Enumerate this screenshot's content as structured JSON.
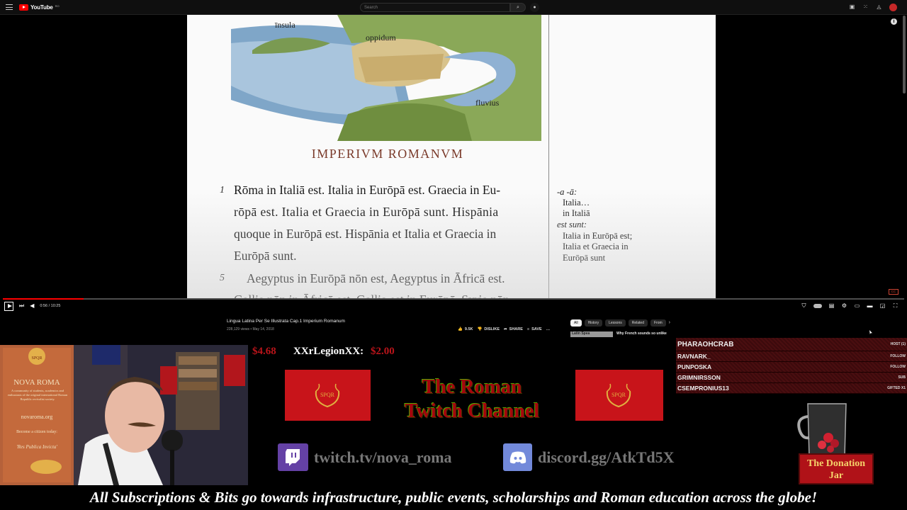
{
  "youtube": {
    "logo": "YouTube",
    "logo_country": "RO",
    "search_placeholder": "Search"
  },
  "book": {
    "labels": {
      "insula": "īnsula",
      "oppidum": "oppidum",
      "fluvius": "fluvius"
    },
    "chapter_title": "IMPERIVM ROMANVM",
    "line_numbers": [
      "1",
      "5"
    ],
    "lines": [
      "Rōma in Italiā est. Italia in Eurōpā est. Graecia in Eu-",
      "rōpā est. Italia et Graecia in Eurōpā sunt. Hispānia",
      "quoque in Eurōpā est. Hispānia et Italia et Graecia in",
      "Eurōpā sunt.",
      "Aegyptus in Eurōpā nōn est, Aegyptus in Āfricā est.",
      "Gallia nōn in Āfricā est, Gallia est in Eurōpā. Syria nōn"
    ],
    "margin_notes": [
      "-a -ā:",
      "Italia…",
      "in Italiā",
      "est sunt:",
      "Italia in Eurōpā est;",
      "Italia et Graecia in",
      "Eurōpā sunt"
    ]
  },
  "player": {
    "time": "0:56 / 10:25",
    "progress": 0.09
  },
  "video": {
    "title": "Lingua Latina Per Se Illustrata Cap.1 Imperium Romanum",
    "meta": "228,129 views • May 14, 2018",
    "likes": "9.5K",
    "dislike": "DISLIKE",
    "share": "SHARE",
    "save": "SAVE",
    "more": "…"
  },
  "chips": [
    "All",
    "History",
    "Lessons",
    "Related",
    "From"
  ],
  "recommended": {
    "thumb": "Latin Spea",
    "title": "Why French sounds so unlike"
  },
  "stream": {
    "donation_amount": "$4.68",
    "donor": "XXrLegionXX:",
    "donor_amount": "$2.00",
    "title_line1": "The Roman",
    "title_line2": "Twitch Channel",
    "spqr": "SPQR",
    "twitch": "twitch.tv/nova_roma",
    "discord": "discord.gg/AtkTd5X",
    "jar_line1": "The Donation",
    "jar_line2": "Jar",
    "footer": "All Subscriptions & Bits  go towards infrastructure, public events, scholarships and Roman education across the globe!",
    "poster": {
      "title": "NOVA ROMA",
      "body": "A community of students, academics and enthusiasts of the original international Roman Republic revivalist society.",
      "url": "novaroma.org",
      "cta": "Become a citizen today:",
      "motto": "'Res Publica Invicta'"
    }
  },
  "events": [
    {
      "name": "PHARAOHCRAB",
      "type": "HOST (1)"
    },
    {
      "name": "RAVNARK_",
      "type": "FOLLOW"
    },
    {
      "name": "PUNPOSKA",
      "type": "FOLLOW"
    },
    {
      "name": "GRIMNIRSSON",
      "type": "SUB"
    },
    {
      "name": "CSEMPRONIUS13",
      "type": "GIFTED X1"
    }
  ],
  "colors": {
    "banner_red": "#c8141a",
    "title_red": "#a5050d",
    "twitch_purple": "#6441a5",
    "discord_blurple": "#7289da",
    "youtube_red": "#ff0000"
  }
}
